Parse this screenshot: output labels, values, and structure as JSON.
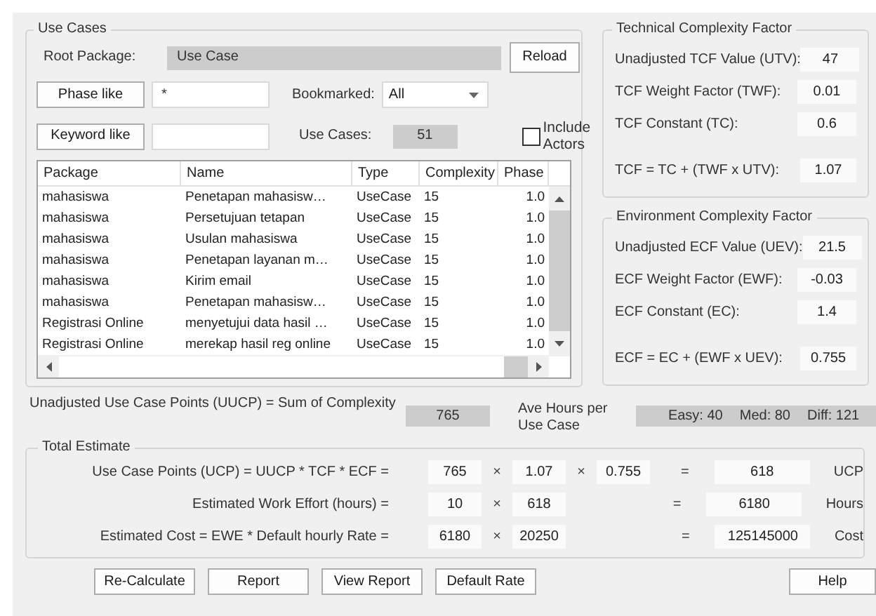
{
  "use_cases": {
    "title": "Use Cases",
    "root_package": {
      "label": "Root Package:",
      "value": "Use Case"
    },
    "reload_button": "Reload",
    "phase_button": "Phase like",
    "phase_value": "*",
    "bookmarked": {
      "label": "Bookmarked:",
      "value": "All"
    },
    "keyword_button": "Keyword like",
    "count": {
      "label": "Use Cases:",
      "value": "51"
    },
    "include_actors": {
      "label": "Include Actors",
      "checked": false
    },
    "table": {
      "columns": [
        "Package",
        "Name",
        "Type",
        "Complexity",
        "Phase"
      ],
      "rows": [
        [
          "mahasiswa",
          "Penetapan mahasisw…",
          "UseCase",
          "15",
          "1.0"
        ],
        [
          "mahasiswa",
          "Persetujuan tetapan",
          "UseCase",
          "15",
          "1.0"
        ],
        [
          "mahasiswa",
          "Usulan mahasiswa",
          "UseCase",
          "15",
          "1.0"
        ],
        [
          "mahasiswa",
          "Penetapan layanan m…",
          "UseCase",
          "15",
          "1.0"
        ],
        [
          "mahasiswa",
          "Kirim email",
          "UseCase",
          "15",
          "1.0"
        ],
        [
          "mahasiswa",
          "Penetapan mahasisw…",
          "UseCase",
          "15",
          "1.0"
        ],
        [
          "Registrasi Online",
          "menyetujui data hasil …",
          "UseCase",
          "15",
          "1.0"
        ],
        [
          "Registrasi Online",
          "merekap hasil reg online",
          "UseCase",
          "15",
          "1.0"
        ]
      ]
    }
  },
  "tcf": {
    "title": "Technical Complexity Factor",
    "rows": [
      {
        "kind": "input",
        "label": "Unadjusted TCF Value (UTV):",
        "value": "47"
      },
      {
        "kind": "input",
        "label": "TCF Weight Factor (TWF):",
        "value": "0.01"
      },
      {
        "kind": "input",
        "label": "TCF Constant (TC):",
        "value": "0.6"
      },
      {
        "kind": "result",
        "label": "TCF = TC + (TWF x UTV):",
        "value": "1.07"
      }
    ]
  },
  "ecf": {
    "title": "Environment Complexity Factor",
    "rows": [
      {
        "kind": "input",
        "label": "Unadjusted ECF Value (UEV):",
        "value": "21.5"
      },
      {
        "kind": "input",
        "label": "ECF Weight Factor (EWF):",
        "value": "-0.03"
      },
      {
        "kind": "input",
        "label": "ECF Constant (EC):",
        "value": "1.4"
      },
      {
        "kind": "result",
        "label": "ECF  = EC + (EWF x UEV):",
        "value": "0.755"
      }
    ]
  },
  "uucp": {
    "label": "Unadjusted Use Case Points (UUCP) = Sum of Complexity",
    "value": "765"
  },
  "ave_hours": {
    "label": "Ave Hours per Use Case",
    "easy": "Easy: 40",
    "med": "Med: 80",
    "diff": "Diff: 121"
  },
  "total_estimate": {
    "title": "Total Estimate",
    "rows": [
      {
        "label": "Use Case Points (UCP) = UUCP * TCF * ECF =",
        "terms": [
          "765",
          "1.07",
          "0.755"
        ],
        "operators": [
          "×",
          "×"
        ],
        "equals": "=",
        "result": "618",
        "unit": "UCP"
      },
      {
        "label": "Estimated Work Effort (hours) =",
        "terms": [
          "10",
          "618"
        ],
        "operators": [
          "×"
        ],
        "equals": "=",
        "result": "6180",
        "unit": "Hours"
      },
      {
        "label": "Estimated Cost  = EWE * Default hourly Rate =",
        "terms": [
          "6180",
          "20250"
        ],
        "operators": [
          "×"
        ],
        "equals": "=",
        "result": "125145000",
        "unit": "Cost"
      }
    ]
  },
  "buttons": [
    "Re-Calculate",
    "Report",
    "View Report",
    "Default Rate"
  ],
  "help_button": "Help"
}
